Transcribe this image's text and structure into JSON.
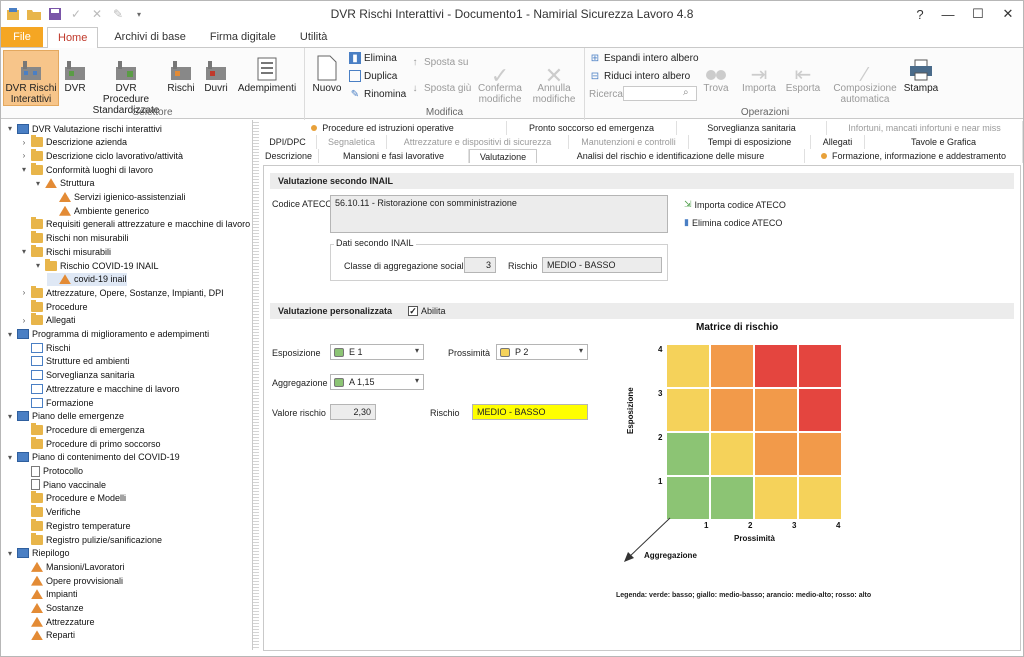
{
  "window": {
    "title": "DVR Rischi Interattivi - Documento1 - Namirial Sicurezza Lavoro 4.8"
  },
  "ribbon_tabs": [
    "File",
    "Home",
    "Archivi di base",
    "Firma digitale",
    "Utilità"
  ],
  "ribbon": {
    "selettore": {
      "label": "Selettore",
      "buttons": [
        "DVR Rischi Interattivi",
        "DVR",
        "DVR Procedure Standardizzate",
        "Rischi",
        "Duvri",
        "Adempimenti"
      ]
    },
    "modifica": {
      "label": "Modifica",
      "nuovo": "Nuovo",
      "elimina": "Elimina",
      "duplica": "Duplica",
      "rinomina": "Rinomina",
      "sposta_su": "Sposta su",
      "sposta_giu": "Sposta giù",
      "conferma": "Conferma modifiche",
      "annulla": "Annulla modifiche"
    },
    "operazioni": {
      "label": "Operazioni",
      "espandi": "Espandi intero albero",
      "riduci": "Riduci intero albero",
      "ricerca": "Ricerca",
      "trova": "Trova",
      "importa": "Importa",
      "esporta": "Esporta",
      "composizione": "Composizione automatica",
      "stampa": "Stampa"
    }
  },
  "tree": [
    {
      "label": "DVR Valutazione rischi interattivi",
      "level": 0,
      "toggle": "▾",
      "icon": "bl"
    },
    {
      "label": "Descrizione azienda",
      "level": 1,
      "toggle": "›",
      "icon": "fo"
    },
    {
      "label": "Descrizione ciclo lavorativo/attività",
      "level": 1,
      "toggle": "›",
      "icon": "fo"
    },
    {
      "label": "Conformità luoghi di lavoro",
      "level": 1,
      "toggle": "▾",
      "icon": "fo"
    },
    {
      "label": "Struttura",
      "level": 2,
      "toggle": "▾",
      "icon": "sp"
    },
    {
      "label": "Servizi igienico-assistenziali",
      "level": 3,
      "toggle": "",
      "icon": "sp"
    },
    {
      "label": "Ambiente generico",
      "level": 3,
      "toggle": "",
      "icon": "sp"
    },
    {
      "label": "Requisiti generali attrezzature e macchine di lavoro",
      "level": 1,
      "toggle": "",
      "icon": "fo"
    },
    {
      "label": "Rischi non misurabili",
      "level": 1,
      "toggle": "",
      "icon": "fo"
    },
    {
      "label": "Rischi misurabili",
      "level": 1,
      "toggle": "▾",
      "icon": "fo"
    },
    {
      "label": "Rischio COVID-19 INAIL",
      "level": 2,
      "toggle": "▾",
      "icon": "fo"
    },
    {
      "label": "covid-19 inail",
      "level": 3,
      "toggle": "",
      "icon": "sp",
      "selected": true
    },
    {
      "label": "Attrezzature, Opere, Sostanze, Impianti, DPI",
      "level": 1,
      "toggle": "›",
      "icon": "fo"
    },
    {
      "label": "Procedure",
      "level": 1,
      "toggle": "",
      "icon": "fo"
    },
    {
      "label": "Allegati",
      "level": 1,
      "toggle": "›",
      "icon": "fo"
    },
    {
      "label": "Programma di miglioramento e adempimenti",
      "level": 0,
      "toggle": "▾",
      "icon": "bl"
    },
    {
      "label": "Rischi",
      "level": 1,
      "toggle": "",
      "icon": "lk"
    },
    {
      "label": "Strutture ed ambienti",
      "level": 1,
      "toggle": "",
      "icon": "lk"
    },
    {
      "label": "Sorveglianza sanitaria",
      "level": 1,
      "toggle": "",
      "icon": "lk"
    },
    {
      "label": "Attrezzature e macchine di lavoro",
      "level": 1,
      "toggle": "",
      "icon": "lk"
    },
    {
      "label": "Formazione",
      "level": 1,
      "toggle": "",
      "icon": "lk"
    },
    {
      "label": "Piano delle emergenze",
      "level": 0,
      "toggle": "▾",
      "icon": "bl"
    },
    {
      "label": "Procedure di emergenza",
      "level": 1,
      "toggle": "",
      "icon": "fo"
    },
    {
      "label": "Procedure di primo soccorso",
      "level": 1,
      "toggle": "",
      "icon": "fo"
    },
    {
      "label": "Piano di contenimento del COVID-19",
      "level": 0,
      "toggle": "▾",
      "icon": "bl"
    },
    {
      "label": "Protocollo",
      "level": 1,
      "toggle": "",
      "icon": "do"
    },
    {
      "label": "Piano vaccinale",
      "level": 1,
      "toggle": "",
      "icon": "do"
    },
    {
      "label": "Procedure e Modelli",
      "level": 1,
      "toggle": "",
      "icon": "fo"
    },
    {
      "label": "Verifiche",
      "level": 1,
      "toggle": "",
      "icon": "fo"
    },
    {
      "label": "Registro temperature",
      "level": 1,
      "toggle": "",
      "icon": "fo"
    },
    {
      "label": "Registro pulizie/sanificazione",
      "level": 1,
      "toggle": "",
      "icon": "fo"
    },
    {
      "label": "Riepilogo",
      "level": 0,
      "toggle": "▾",
      "icon": "bl"
    },
    {
      "label": "Mansioni/Lavoratori",
      "level": 1,
      "toggle": "",
      "icon": "sp"
    },
    {
      "label": "Opere provvisionali",
      "level": 1,
      "toggle": "",
      "icon": "sp"
    },
    {
      "label": "Impianti",
      "level": 1,
      "toggle": "",
      "icon": "sp"
    },
    {
      "label": "Sostanze",
      "level": 1,
      "toggle": "",
      "icon": "sp"
    },
    {
      "label": "Attrezzature",
      "level": 1,
      "toggle": "",
      "icon": "sp"
    },
    {
      "label": "Reparti",
      "level": 1,
      "toggle": "",
      "icon": "sp"
    }
  ],
  "content_tabs": {
    "row1": [
      {
        "label": "Procedure ed istruzioni operative",
        "dot": true,
        "disabled": false
      },
      {
        "label": "Pronto soccorso ed emergenza",
        "dot": false,
        "disabled": false
      },
      {
        "label": "Sorveglianza sanitaria",
        "dot": false,
        "disabled": false
      },
      {
        "label": "Infortuni, mancati infortuni e near miss",
        "dot": false,
        "disabled": true
      }
    ],
    "row2": [
      {
        "label": "DPI/DPC",
        "disabled": false
      },
      {
        "label": "Segnaletica",
        "disabled": true
      },
      {
        "label": "Attrezzature e dispositivi di sicurezza",
        "disabled": true
      },
      {
        "label": "Manutenzioni e controlli",
        "disabled": true
      },
      {
        "label": "Tempi di esposizione",
        "disabled": false
      },
      {
        "label": "Allegati",
        "disabled": false
      },
      {
        "label": "Tavole e Grafica",
        "disabled": false
      }
    ],
    "row3": [
      {
        "label": "Descrizione",
        "dot": false
      },
      {
        "label": "Mansioni e fasi lavorative",
        "dot": false
      },
      {
        "label": "Valutazione",
        "dot": false,
        "active": true
      },
      {
        "label": "Analisi del rischio e identificazione delle misure",
        "dot": false
      },
      {
        "label": "Formazione, informazione e addestramento",
        "dot": true
      }
    ]
  },
  "inail": {
    "section_title": "Valutazione secondo INAIL",
    "codice_label": "Codice ATECO",
    "codice_value": "56.10.11 - Ristorazione con somministrazione",
    "importa": "Importa codice ATECO",
    "elimina": "Elimina codice ATECO",
    "dati_title": "Dati secondo INAIL",
    "classe_label": "Classe di aggregazione sociale",
    "classe_value": "3",
    "rischio_label": "Rischio",
    "rischio_value": "MEDIO - BASSO"
  },
  "personalizzata": {
    "section_title": "Valutazione personalizzata",
    "abilita": "Abilita",
    "abilita_checked": true,
    "esposizione_label": "Esposizione",
    "esposizione_value": "E 1",
    "prossimita_label": "Prossimità",
    "prossimita_value": "P 2",
    "aggregazione_label": "Aggregazione",
    "aggregazione_value": "A 1,15",
    "valore_label": "Valore rischio",
    "valore_value": "2,30",
    "rischio_label": "Rischio",
    "rischio_value": "MEDIO - BASSO",
    "colors": {
      "green": "#8cc474",
      "yellow": "#f5d25a",
      "orange": "#f29a4a",
      "red": "#e4453f",
      "highlight": "#ffff00"
    }
  },
  "matrix": {
    "title": "Matrice di rischio",
    "x_label": "Prossimità",
    "y_label": "Esposizione",
    "z_label": "Aggregazione",
    "x_ticks": [
      "1",
      "2",
      "3",
      "4"
    ],
    "y_ticks": [
      "1",
      "2",
      "3",
      "4"
    ],
    "rows_top_to_bottom": [
      [
        "yellow",
        "orange",
        "red",
        "red"
      ],
      [
        "yellow",
        "orange",
        "orange",
        "red"
      ],
      [
        "green",
        "yellow",
        "orange",
        "orange"
      ],
      [
        "green",
        "green",
        "yellow",
        "yellow"
      ]
    ],
    "legend": "Legenda: verde: basso; giallo: medio-basso; arancio: medio-alto; rosso: alto"
  }
}
